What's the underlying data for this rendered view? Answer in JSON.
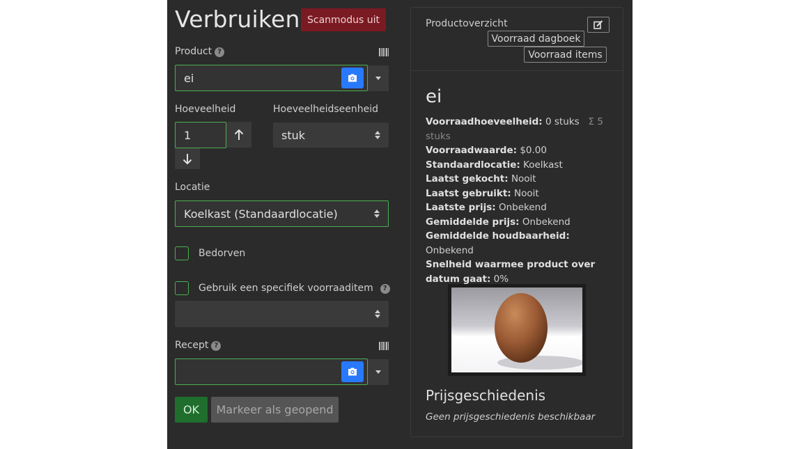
{
  "header": {
    "title": "Verbruiken",
    "scan_button": "Scanmodus uit"
  },
  "form": {
    "product": {
      "label": "Product",
      "value": "ei"
    },
    "quantity": {
      "label": "Hoeveelheid",
      "value": "1"
    },
    "unit": {
      "label": "Hoeveelheidseenheid",
      "value": "stuk"
    },
    "location": {
      "label": "Locatie",
      "value": "Koelkast (Standaardlocatie)"
    },
    "spoiled": {
      "label": "Bedorven"
    },
    "specific_item": {
      "label": "Gebruik een specifiek voorraaditem"
    },
    "recipe": {
      "label": "Recept",
      "value": ""
    },
    "ok_button": "OK",
    "open_button": "Markeer als geopend"
  },
  "product_card": {
    "heading": "Productoverzicht",
    "journal_button": "Voorraad dagboek",
    "items_button": "Voorraad items",
    "name": "ei",
    "stats": {
      "stock_amount_label": "Voorraadhoeveelheid:",
      "stock_amount_value": "0 stuks",
      "stock_sum": "Σ 5",
      "stock_sum_unit": "stuks",
      "stock_value_label": "Voorraadwaarde:",
      "stock_value_value": "$0.00",
      "default_location_label": "Standaardlocatie:",
      "default_location_value": "Koelkast",
      "last_purchased_label": "Laatst gekocht:",
      "last_purchased_value": "Nooit",
      "last_used_label": "Laatst gebruikt:",
      "last_used_value": "Nooit",
      "last_price_label": "Laatste prijs:",
      "last_price_value": "Onbekend",
      "avg_price_label": "Gemiddelde prijs:",
      "avg_price_value": "Onbekend",
      "avg_shelf_life_label": "Gemiddelde houdbaarheid:",
      "avg_shelf_life_value": "Onbekend",
      "spoil_rate_label_1": "Snelheid waarmee product over",
      "spoil_rate_label_2": "datum gaat:",
      "spoil_rate_value": "0%"
    },
    "price_history_title": "Prijsgeschiedenis",
    "price_history_empty": "Geen prijsgeschiedenis beschikbaar"
  }
}
